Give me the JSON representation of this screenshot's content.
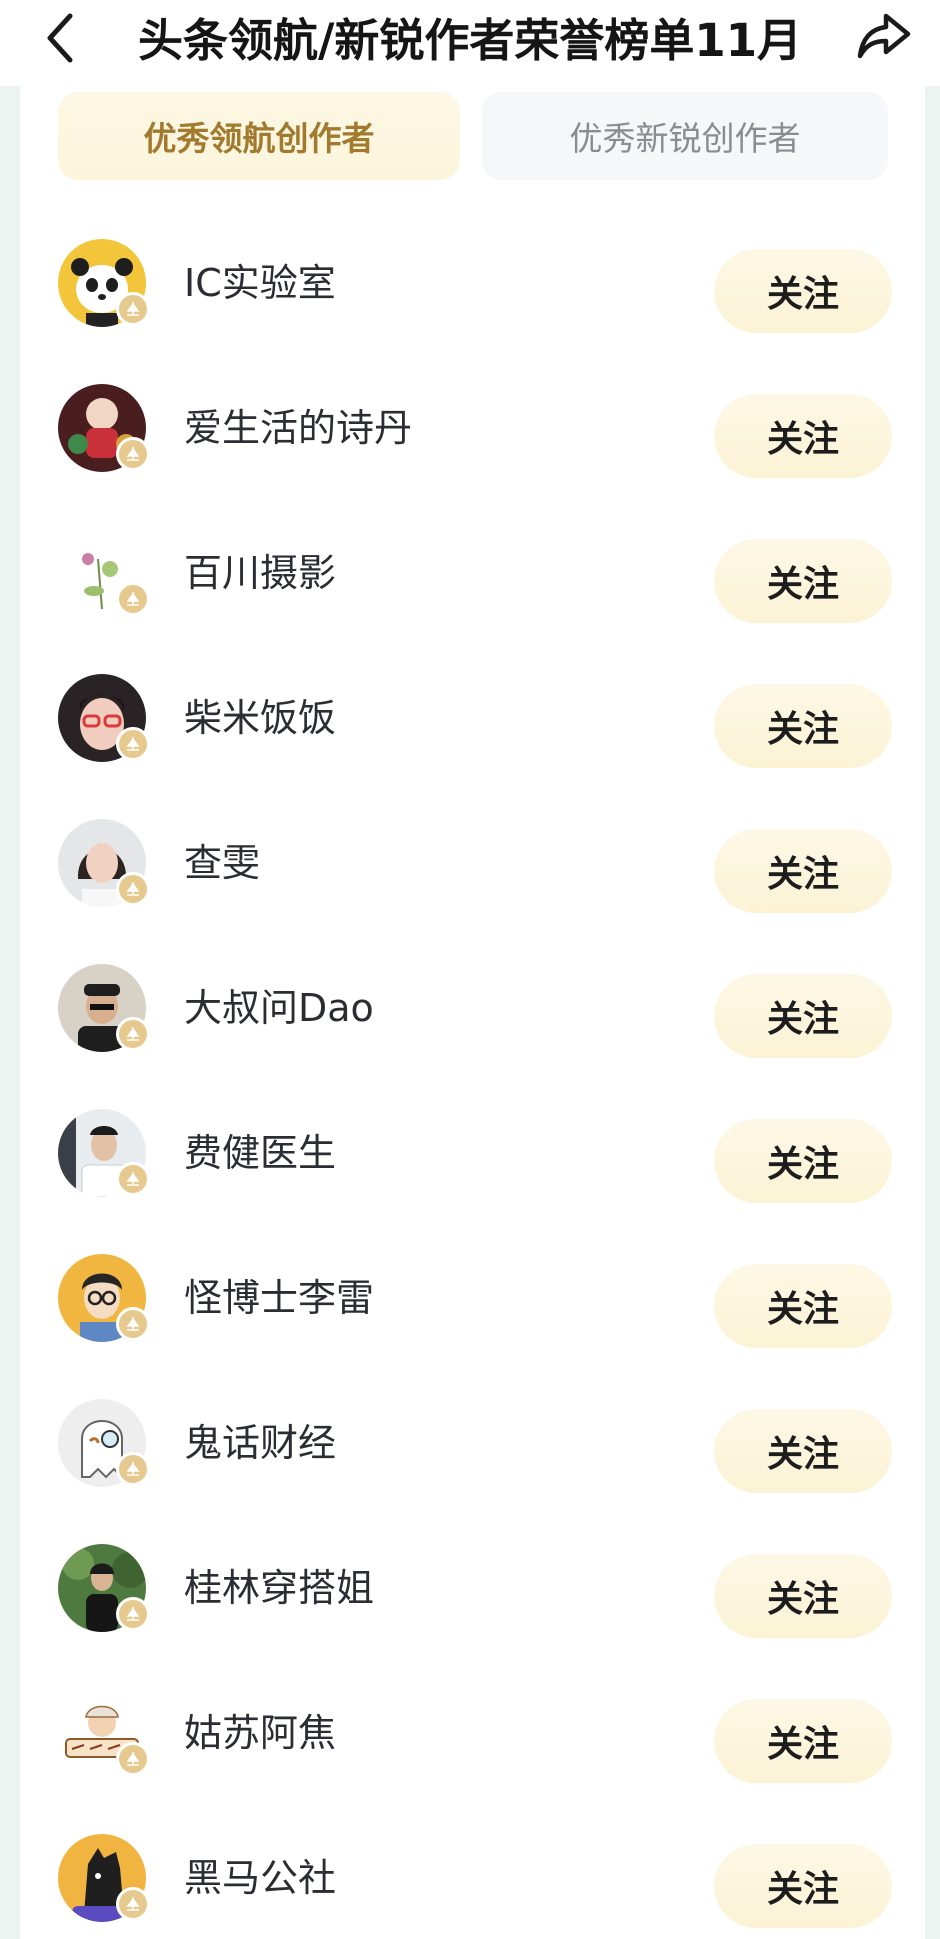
{
  "header": {
    "title": "头条领航/新锐作者荣誉榜单11月",
    "back_icon": "chevron-left-icon",
    "share_icon": "share-arrow-icon"
  },
  "tabs": [
    {
      "label": "优秀领航创作者",
      "active": true
    },
    {
      "label": "优秀新锐创作者",
      "active": false
    }
  ],
  "colors": {
    "accent_text": "#a27a2e",
    "follow_bg": "#fcf3d5",
    "badge": "#e6c98f"
  },
  "users": [
    {
      "name": "IC实验室",
      "follow_label": "关注",
      "avatar": "panda-avatar-icon"
    },
    {
      "name": "爱生活的诗丹",
      "follow_label": "关注",
      "avatar": "figurine-avatar-icon"
    },
    {
      "name": "百川摄影",
      "follow_label": "关注",
      "avatar": "flower-avatar-icon"
    },
    {
      "name": "柴米饭饭",
      "follow_label": "关注",
      "avatar": "woman-glasses-avatar-icon"
    },
    {
      "name": "查雯",
      "follow_label": "关注",
      "avatar": "woman-portrait-avatar-icon"
    },
    {
      "name": "大叔问Dao",
      "follow_label": "关注",
      "avatar": "man-cap-avatar-icon"
    },
    {
      "name": "费健医生",
      "follow_label": "关注",
      "avatar": "doctor-avatar-icon"
    },
    {
      "name": "怪博士李雷",
      "follow_label": "关注",
      "avatar": "cartoon-man-avatar-icon"
    },
    {
      "name": "鬼话财经",
      "follow_label": "关注",
      "avatar": "ghost-avatar-icon"
    },
    {
      "name": "桂林穿搭姐",
      "follow_label": "关注",
      "avatar": "outdoor-woman-avatar-icon"
    },
    {
      "name": "姑苏阿焦",
      "follow_label": "关注",
      "avatar": "chef-cartoon-avatar-icon"
    },
    {
      "name": "黑马公社",
      "follow_label": "关注",
      "avatar": "black-horse-avatar-icon"
    }
  ]
}
